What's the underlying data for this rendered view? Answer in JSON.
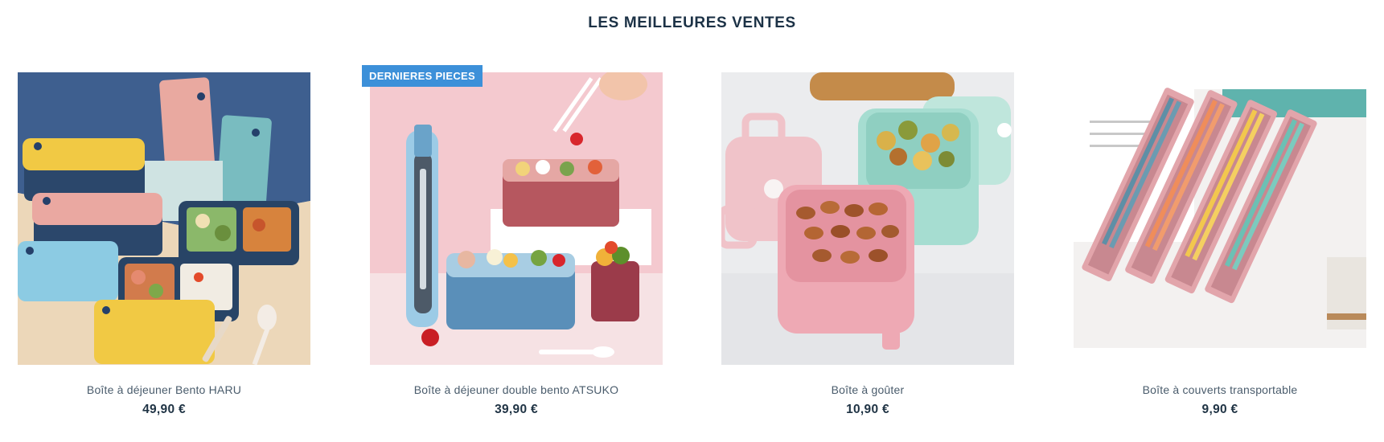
{
  "section": {
    "title": "LES MEILLEURES VENTES"
  },
  "products": [
    {
      "name": "Boîte à déjeuner Bento HARU",
      "price": "49,90 €",
      "image_icon": "bento-lunchbox-image"
    },
    {
      "name": "Boîte à déjeuner double bento ATSUKO",
      "price": "39,90 €",
      "badge": "DERNIERES PIECES",
      "image_icon": "double-bento-image"
    },
    {
      "name": "Boîte à goûter",
      "price": "10,90 €",
      "image_icon": "snack-box-image"
    },
    {
      "name": "Boîte à couverts transportable",
      "price": "9,90 €",
      "image_icon": "cutlery-box-image"
    }
  ],
  "colors": {
    "title": "#1c3246",
    "badge_bg": "#3c90d9",
    "price": "#1f3344",
    "name": "#4a5c6c"
  }
}
